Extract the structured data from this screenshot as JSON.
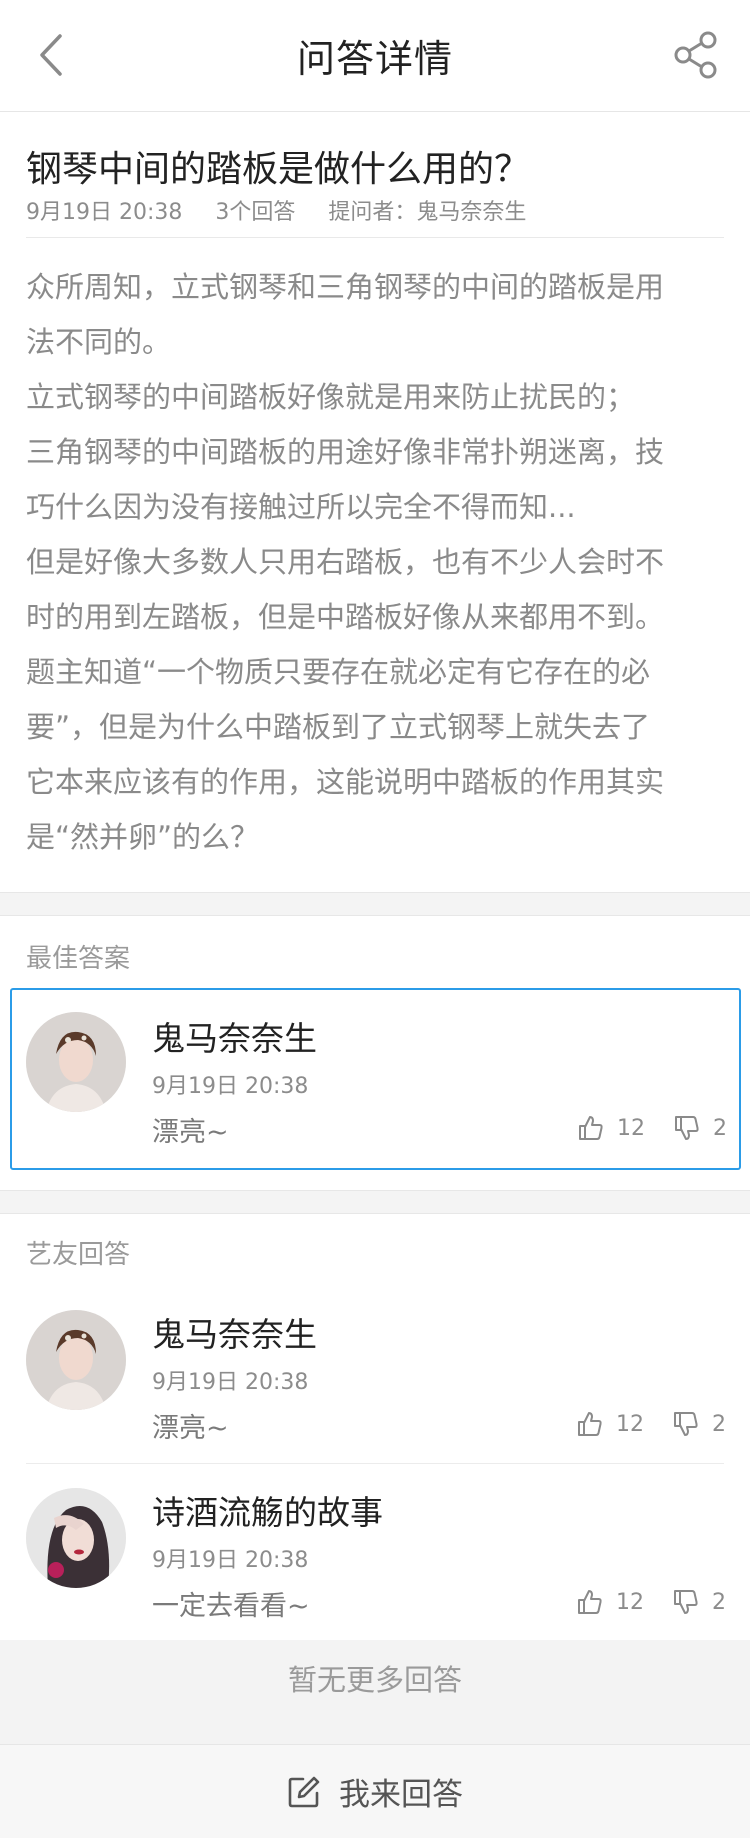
{
  "header": {
    "title": "问答详情",
    "back_icon": "chevron-left-icon",
    "share_icon": "share-icon"
  },
  "question": {
    "title": "钢琴中间的踏板是做什么用的？",
    "time": "9月19日 20:38",
    "answer_count": "3个回答",
    "asker": "提问者：鬼马奈奈生",
    "body": "众所周知，立式钢琴和三角钢琴的中间的踏板是用\n法不同的。\n立式钢琴的中间踏板好像就是用来防止扰民的；\n三角钢琴的中间踏板的用途好像非常扑朔迷离，技\n巧什么因为没有接触过所以完全不得而知...\n但是好像大多数人只用右踏板，也有不少人会时不\n时的用到左踏板，但是中踏板好像从来都用不到。\n题主知道“一个物质只要存在就必定有它存在的必\n要”，但是为什么中踏板到了立式钢琴上就失去了\n它本来应该有的作用，这能说明中踏板的作用其实\n是“然并卵”的么？"
  },
  "best": {
    "label": "最佳答案",
    "answer": {
      "name": "鬼马奈奈生",
      "time": "9月19日 20:38",
      "text": "漂亮~",
      "likes": "12",
      "dislikes": "2"
    }
  },
  "others": {
    "label": "艺友回答",
    "answers": [
      {
        "name": "鬼马奈奈生",
        "time": "9月19日 20:38",
        "text": "漂亮~",
        "likes": "12",
        "dislikes": "2"
      },
      {
        "name": "诗酒流觞的故事",
        "time": "9月19日 20:38",
        "text": "一定去看看~",
        "likes": "12",
        "dislikes": "2"
      }
    ]
  },
  "no_more": "暂无更多回答",
  "footer": {
    "label": "我来回答",
    "icon": "edit-icon"
  },
  "colors": {
    "accent": "#2b9ce8",
    "muted": "#8c8c8c"
  }
}
